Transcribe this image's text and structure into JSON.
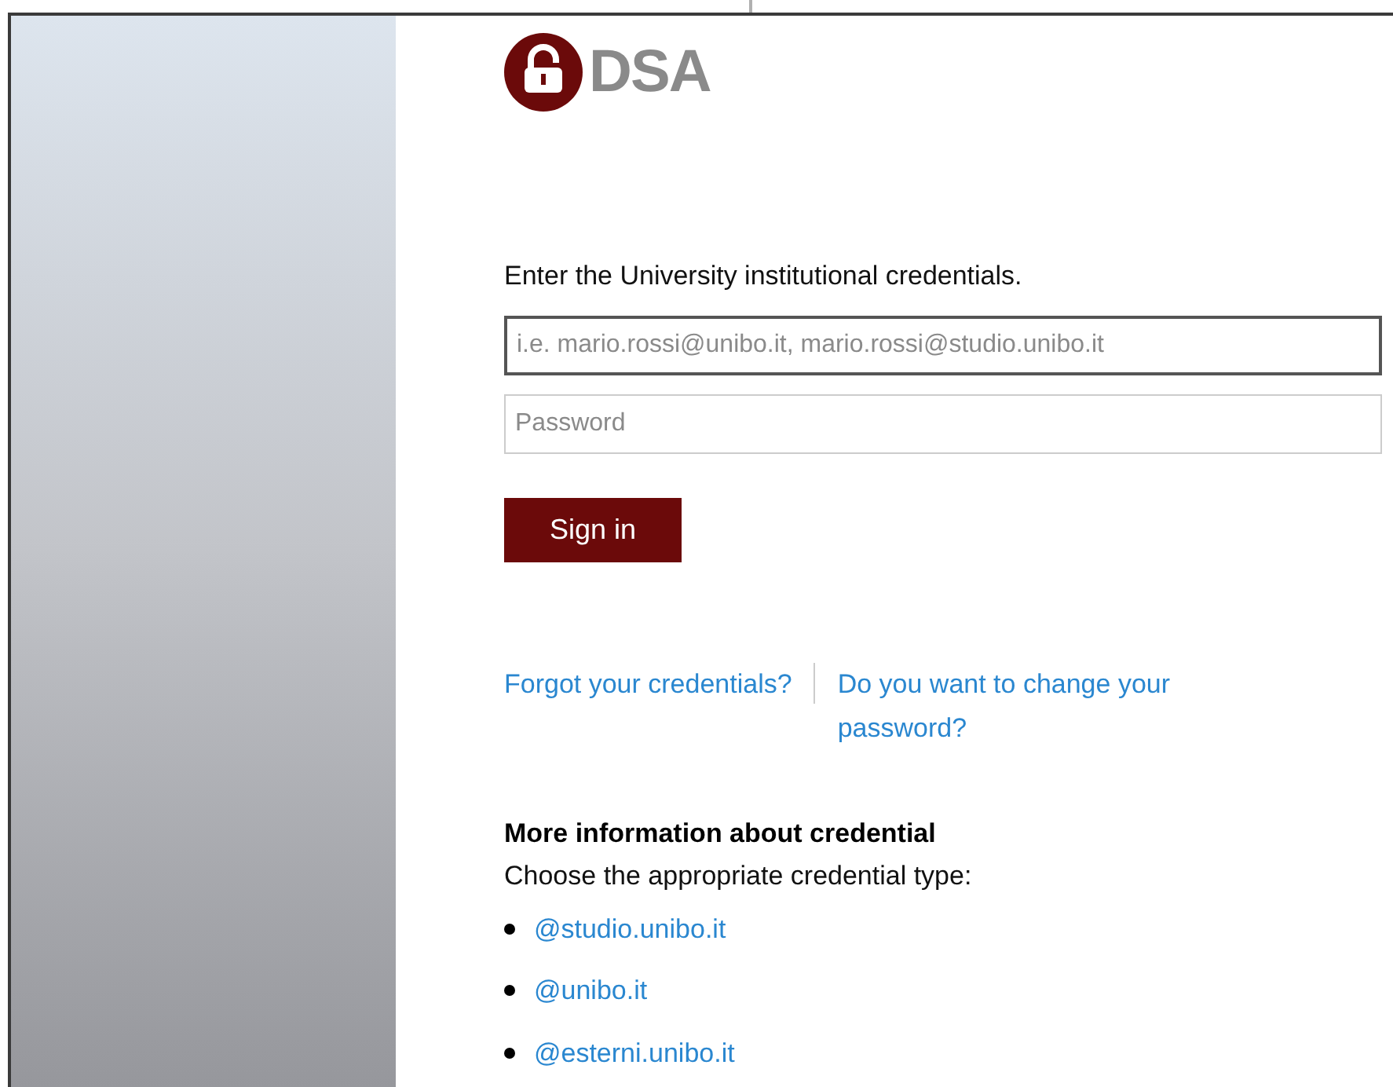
{
  "logo": {
    "text": "DSA"
  },
  "intro": "Enter the University institutional credentials.",
  "username": {
    "placeholder": "i.e. mario.rossi@unibo.it, mario.rossi@studio.unibo.it",
    "focused": true
  },
  "password": {
    "placeholder": "Password"
  },
  "sign_in_button": "Sign in",
  "links": [
    "Forgot your credentials?",
    "Do you want to change your password?"
  ],
  "more_info": {
    "title": "More information about credential",
    "subtitle": "Choose the appropriate credential type:",
    "items": [
      "@studio.unibo.it",
      "@unibo.it",
      "@esterni.unibo.it"
    ]
  }
}
